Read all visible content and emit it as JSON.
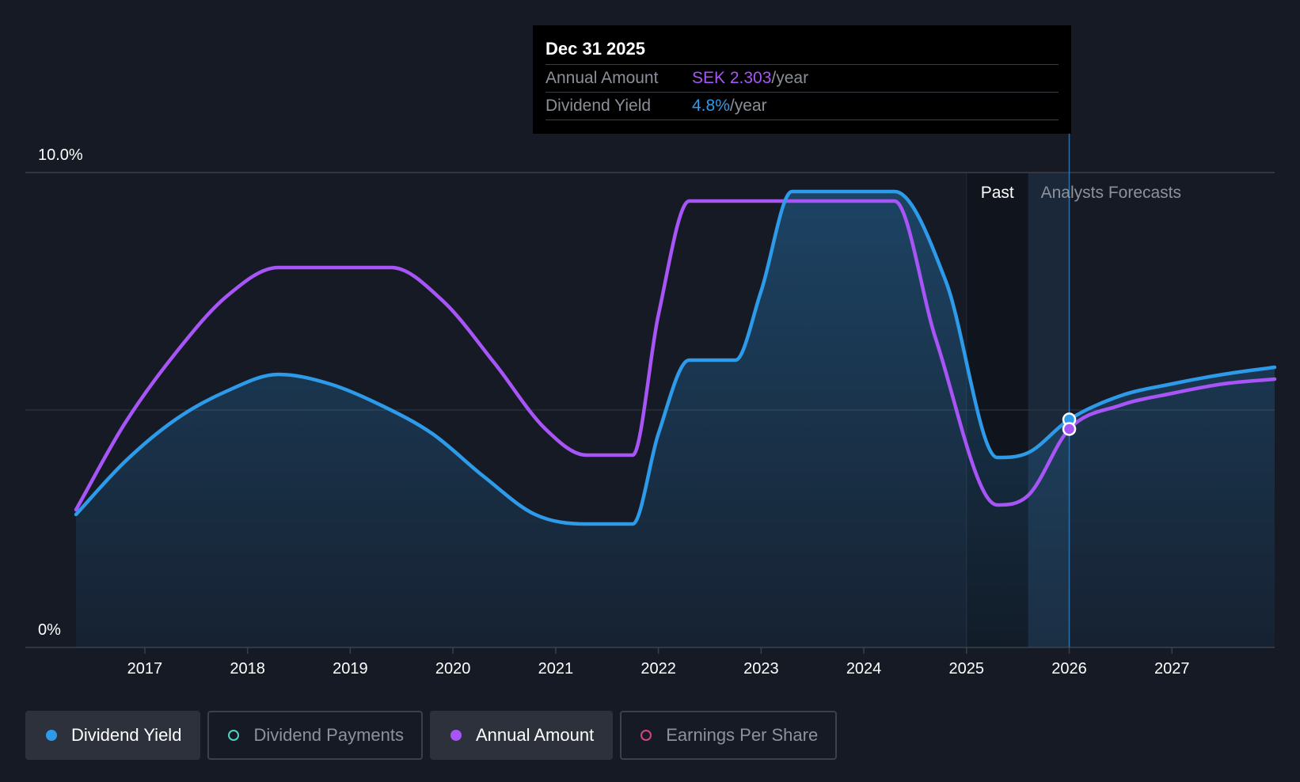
{
  "tooltip": {
    "date": "Dec 31 2025",
    "rows": [
      {
        "label": "Annual Amount",
        "value": "SEK 2.303",
        "unit": "/year",
        "color": "#a855f7"
      },
      {
        "label": "Dividend Yield",
        "value": "4.8%",
        "unit": "/year",
        "color": "#2d9be9"
      }
    ]
  },
  "legend": [
    {
      "label": "Dividend Yield",
      "color": "#2d9be9",
      "active": true,
      "filled": true
    },
    {
      "label": "Dividend Payments",
      "color": "#4fd1c5",
      "active": false,
      "filled": false
    },
    {
      "label": "Annual Amount",
      "color": "#a855f7",
      "active": true,
      "filled": true
    },
    {
      "label": "Earnings Per Share",
      "color": "#d6457a",
      "active": false,
      "filled": false
    }
  ],
  "chart_data": {
    "type": "line",
    "y_tick_labels": [
      "10.0%",
      "0%"
    ],
    "ylim": [
      0,
      10
    ],
    "x_ticks": [
      "2017",
      "2018",
      "2019",
      "2020",
      "2021",
      "2022",
      "2023",
      "2024",
      "2025",
      "2026",
      "2027"
    ],
    "xlim": [
      2016.33,
      2028.0
    ],
    "grid": "horizontal",
    "regions": {
      "past_label": "Past",
      "forecast_label": "Analysts Forecasts",
      "past_start": 2025.0,
      "forecast_start": 2025.6
    },
    "cursor_x": 2026.0,
    "series": [
      {
        "name": "Dividend Yield",
        "color": "#2d9be9",
        "area": true,
        "points": [
          [
            2016.33,
            2.8
          ],
          [
            2016.8,
            3.9
          ],
          [
            2017.3,
            4.8
          ],
          [
            2017.8,
            5.4
          ],
          [
            2018.3,
            5.75
          ],
          [
            2018.8,
            5.55
          ],
          [
            2019.3,
            5.1
          ],
          [
            2019.8,
            4.5
          ],
          [
            2020.3,
            3.6
          ],
          [
            2020.8,
            2.8
          ],
          [
            2021.3,
            2.6
          ],
          [
            2021.75,
            2.6
          ],
          [
            2022.0,
            4.5
          ],
          [
            2022.3,
            6.05
          ],
          [
            2022.75,
            6.05
          ],
          [
            2023.0,
            7.5
          ],
          [
            2023.3,
            9.6
          ],
          [
            2024.3,
            9.6
          ],
          [
            2024.8,
            7.7
          ],
          [
            2025.3,
            4.0
          ],
          [
            2025.6,
            4.1
          ],
          [
            2026.0,
            4.8
          ],
          [
            2026.5,
            5.3
          ],
          [
            2027.0,
            5.55
          ],
          [
            2027.5,
            5.75
          ],
          [
            2028.0,
            5.9
          ]
        ]
      },
      {
        "name": "Annual Amount",
        "color": "#a855f7",
        "area": false,
        "points": [
          [
            2016.33,
            2.9
          ],
          [
            2016.8,
            4.7
          ],
          [
            2017.3,
            6.2
          ],
          [
            2017.8,
            7.4
          ],
          [
            2018.3,
            8.0
          ],
          [
            2019.4,
            8.0
          ],
          [
            2019.9,
            7.3
          ],
          [
            2020.4,
            6.0
          ],
          [
            2020.9,
            4.6
          ],
          [
            2021.3,
            4.05
          ],
          [
            2021.75,
            4.05
          ],
          [
            2022.0,
            7.0
          ],
          [
            2022.3,
            9.4
          ],
          [
            2024.3,
            9.4
          ],
          [
            2024.7,
            6.5
          ],
          [
            2025.3,
            3.0
          ],
          [
            2025.6,
            3.2
          ],
          [
            2026.0,
            4.6
          ],
          [
            2026.5,
            5.1
          ],
          [
            2027.0,
            5.35
          ],
          [
            2027.5,
            5.55
          ],
          [
            2028.0,
            5.65
          ]
        ]
      }
    ]
  }
}
